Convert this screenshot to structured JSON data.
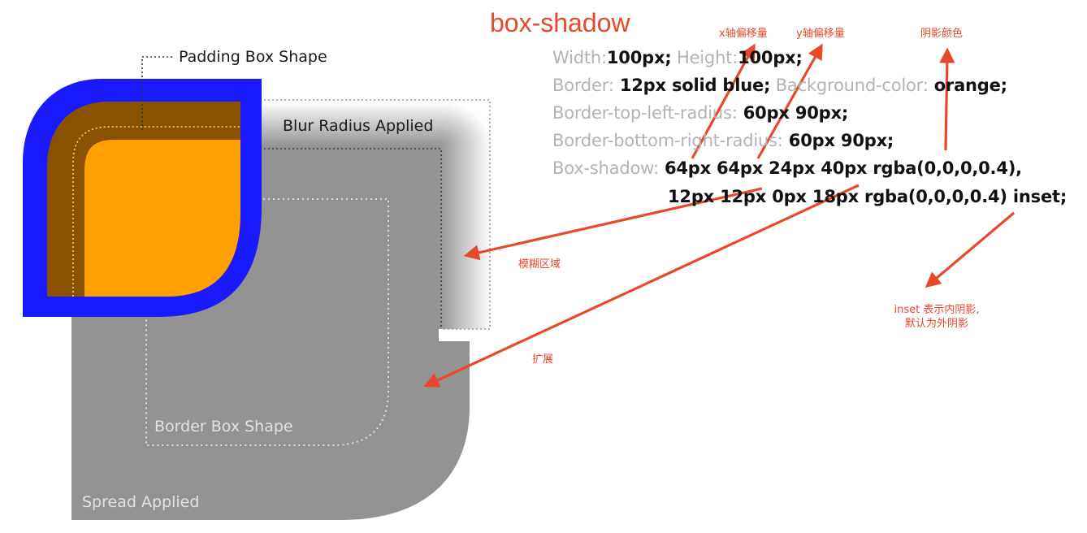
{
  "title": "box-shadow",
  "annotations": {
    "x_offset": "x轴偏移量",
    "y_offset": "y轴偏移量",
    "shadow_color": "阴影颜色",
    "blur_area": "模糊区域",
    "spread": "扩展",
    "inset_line1": "inset 表示内阴影,",
    "inset_line2": "默认为外阴影"
  },
  "figure_labels": {
    "padding_box": "Padding Box Shape",
    "blur_radius": "Blur Radius Applied",
    "border_box": "Border Box Shape",
    "spread_applied": "Spread Applied"
  },
  "code": {
    "line1": {
      "width_key": "Width:",
      "width_val": "100px;",
      "height_key": " Height:",
      "height_val": "100px;"
    },
    "line2": {
      "border_key": "Border:",
      "border_val": " 12px solid blue;",
      "bg_key": " Background-color:",
      "bg_val": " orange;"
    },
    "line3": {
      "key": "Border-top-left-radius:",
      "val": "  60px 90px;"
    },
    "line4": {
      "key": "Border-bottom-right-radius:",
      "val": "  60px 90px;"
    },
    "line5": {
      "key": "Box-shadow:",
      "val": " 64px 64px 24px 40px rgba(0,0,0,0.4),"
    },
    "line6": {
      "val": "12px 12px 0px 18px rgba(0,0,0,0.4) inset;"
    }
  },
  "colors": {
    "annotation": "#e8492a",
    "border": "#1a1aff",
    "padding_fill": "#ffa000",
    "inset_shadow": "#8a5200",
    "spread_shadow": "#939393"
  }
}
